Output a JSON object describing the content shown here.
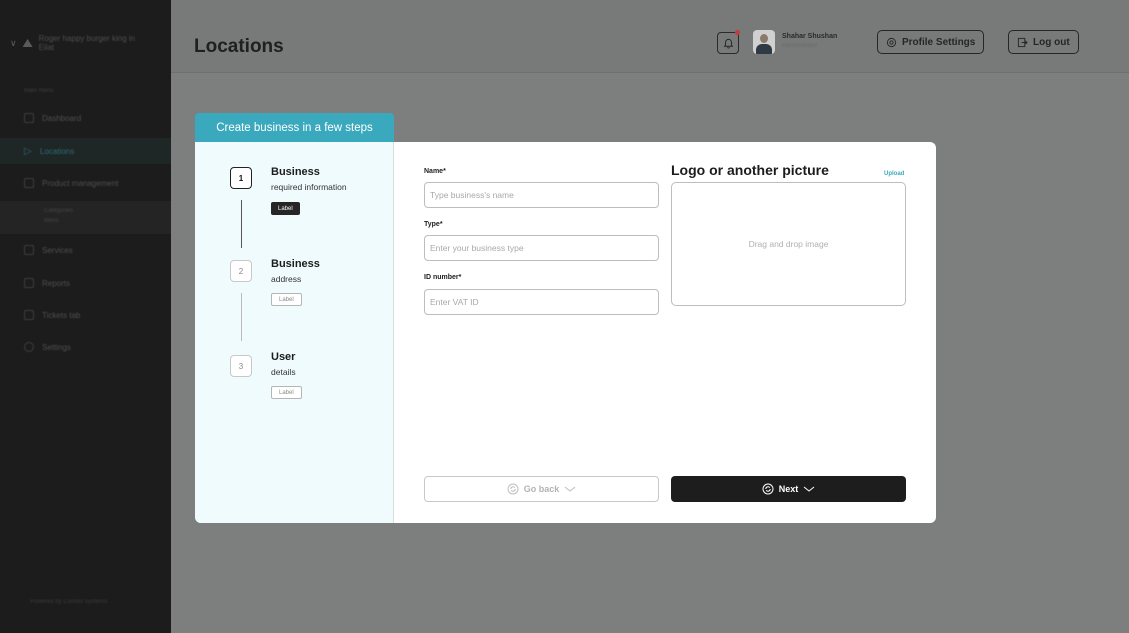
{
  "sidebar": {
    "business_name": "Roger happy burger king in Eilat",
    "section_label": "Main menu",
    "items": [
      {
        "label": "Dashboard",
        "icon": "dashboard-icon"
      },
      {
        "label": "Locations",
        "icon": "location-arrow-icon"
      },
      {
        "label": "Product management",
        "icon": "product-icon"
      },
      {
        "label": "Services",
        "icon": "services-icon"
      },
      {
        "label": "Reports",
        "icon": "reports-icon"
      },
      {
        "label": "Tickets tab",
        "icon": "tickets-icon"
      },
      {
        "label": "Settings",
        "icon": "settings-icon"
      }
    ],
    "subitems": [
      "Categories",
      "Items"
    ],
    "footer": "Powered by Combo Systems"
  },
  "header": {
    "title": "Locations",
    "user_name": "Shahar Shushan",
    "user_role": "Administrator",
    "profile_settings_label": "Profile Settings",
    "logout_label": "Log out"
  },
  "wizard": {
    "tab_label": "Create business in a few steps",
    "steps": [
      {
        "num": "1",
        "title": "Business",
        "subtitle": "required information",
        "badge": "Label"
      },
      {
        "num": "2",
        "title": "Business",
        "subtitle": "address",
        "badge": "Label"
      },
      {
        "num": "3",
        "title": "User",
        "subtitle": "details",
        "badge": "Label"
      }
    ],
    "fields": {
      "name_label": "Name*",
      "name_placeholder": "Type business's name",
      "type_label": "Type*",
      "type_placeholder": "Enter your business type",
      "id_label": "ID number*",
      "id_placeholder": "Enter VAT ID"
    },
    "logo_title": "Logo or another picture",
    "upload_label": "Upload",
    "dropzone_text": "Drag and drop image",
    "back_label": "Go back",
    "next_label": "Next"
  },
  "colors": {
    "accent": "#3aa9bd",
    "sidebar_bg": "#1c1c1c",
    "overlay_bg": "#7d7e7e",
    "primary_button": "#1d1d1d"
  }
}
